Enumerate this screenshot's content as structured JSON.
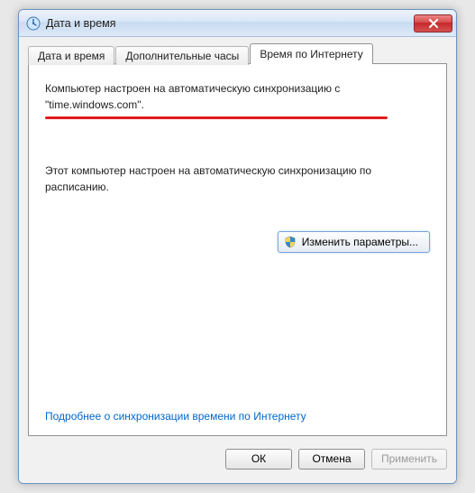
{
  "window": {
    "title": "Дата и время"
  },
  "tabs": {
    "t0": "Дата и время",
    "t1": "Дополнительные часы",
    "t2": "Время по Интернету"
  },
  "content": {
    "sync_line": "Компьютер настроен на автоматическую синхронизацию с \"time.windows.com\".",
    "schedule_line": "Этот компьютер настроен на автоматическую синхронизацию по расписанию.",
    "change_settings": "Изменить параметры...",
    "help_link": "Подробнее о синхронизации времени по Интернету"
  },
  "footer": {
    "ok": "ОК",
    "cancel": "Отмена",
    "apply": "Применить"
  }
}
